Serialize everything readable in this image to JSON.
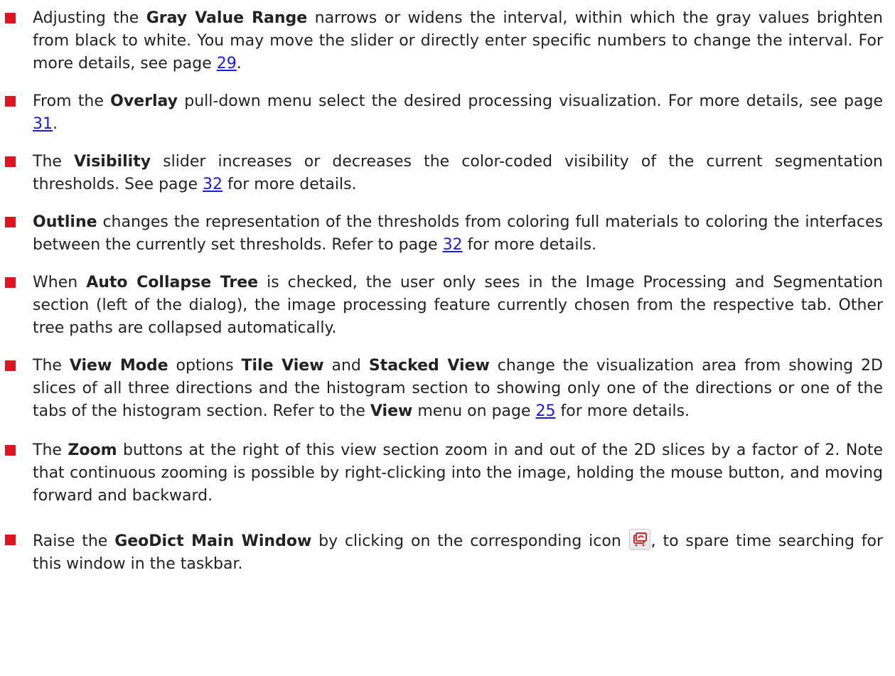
{
  "items": [
    {
      "pre": "Adjusting the ",
      "bold": "Gray Value Range",
      "mid": " narrows or widens the interval, within which the gray values brighten from black to white. You may move the slider or directly enter specific numbers to change the interval. For more details, see page ",
      "link": "29",
      "post": "."
    },
    {
      "pre": "From the ",
      "bold": "Overlay",
      "mid": " pull-down menu select the desired processing visualization. For more details, see page ",
      "link": "31",
      "post": "."
    },
    {
      "pre": "The ",
      "bold": "Visibility",
      "mid": " slider increases or decreases the color-coded visibility of the current segmentation thresholds. See page ",
      "link": "32",
      "post": " for more details."
    },
    {
      "pre": "",
      "bold": "Outline",
      "mid": " changes the representation of the thresholds from coloring full materials to coloring the interfaces between the currently set thresholds. Refer to page ",
      "link": "32",
      "post": " for more details."
    },
    {
      "pre": "When ",
      "bold": "Auto Collapse Tree",
      "mid": " is checked, the user only sees in the Image Processing and Segmentation section (left of the dialog), the image processing feature currently chosen from the respective tab. Other tree paths are collapsed automatically."
    },
    {
      "pre": "The ",
      "bold": "View Mode",
      "mid": " options ",
      "bold2": "Tile View",
      "mid2": " and ",
      "bold3": "Stacked View",
      "mid3": " change the visualization area from showing 2D slices of all three directions and the histogram section to showing only one of the directions or one of the tabs of the histogram section. Refer to the ",
      "bold4": "View",
      "mid4": " menu on page ",
      "link": "25",
      "post": " for more details."
    },
    {
      "pre": "The ",
      "bold": "Zoom",
      "mid": " buttons at the right of this view section zoom in and out of the 2D slices by a factor of 2. Note that continuous zooming is possible by right-clicking into the image, holding the mouse button, and moving forward and backward."
    },
    {
      "pre": "Raise the ",
      "bold": "GeoDict Main Window",
      "mid": " by clicking on the corresponding icon ",
      "icon": "geodict-main-window-icon",
      "post": ", to spare time searching for this window in the taskbar."
    }
  ],
  "colors": {
    "bullet": "#e0141e",
    "link": "#1a1ae6",
    "text": "#222222"
  }
}
